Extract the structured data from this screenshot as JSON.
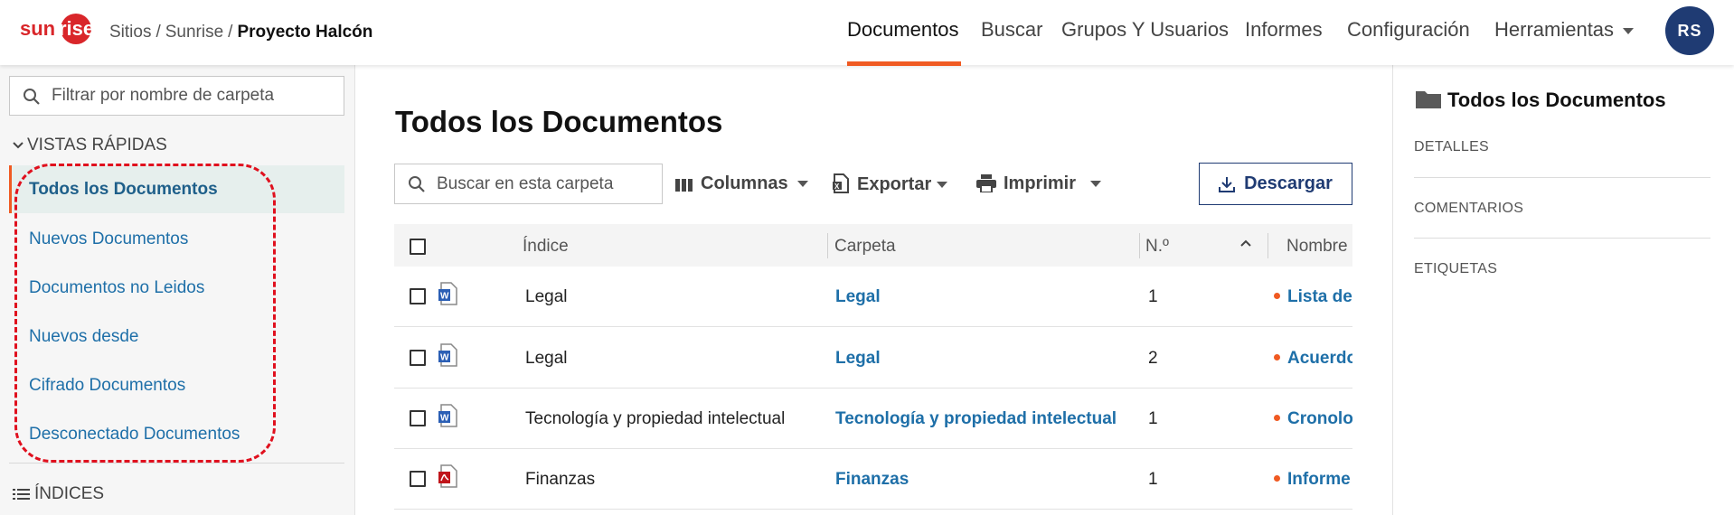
{
  "header": {
    "logo_text": "sunrise",
    "breadcrumb": [
      "Sitios",
      "Sunrise",
      "Proyecto Halcón"
    ],
    "breadcrumb_sep": "/",
    "nav": [
      "Documentos",
      "Buscar",
      "Grupos Y Usuarios",
      "Informes",
      "Configuración",
      "Herramientas"
    ],
    "active_nav": "Documentos",
    "user_initials": "RS"
  },
  "sidebar": {
    "filter_placeholder": "Filtrar por nombre de carpeta",
    "quick_views_title": "VISTAS RÁPIDAS",
    "quick_views": [
      "Todos los Documentos",
      "Nuevos Documentos",
      "Documentos no Leidos",
      "Nuevos desde",
      "Cifrado Documentos",
      "Desconectado Documentos"
    ],
    "active_view": "Todos los Documentos",
    "indices_title": "ÍNDICES"
  },
  "main": {
    "title": "Todos los Documentos",
    "search_placeholder": "Buscar en esta carpeta",
    "toolbar": {
      "columns": "Columnas",
      "export": "Exportar",
      "print": "Imprimir",
      "download": "Descargar"
    },
    "table": {
      "headers": [
        "Índice",
        "Carpeta",
        "N.º",
        "Nombre"
      ],
      "rows": [
        {
          "index": "Legal",
          "folder": "Legal",
          "number": "1",
          "name": "Lista de",
          "file_type": "word"
        },
        {
          "index": "Legal",
          "folder": "Legal",
          "number": "2",
          "name": "Acuerdo",
          "file_type": "word"
        },
        {
          "index": "Tecnología y propiedad intelectual",
          "folder": "Tecnología y propiedad intelectual",
          "number": "1",
          "name": "Cronolog",
          "file_type": "word"
        },
        {
          "index": "Finanzas",
          "folder": "Finanzas",
          "number": "1",
          "name": "Informe",
          "file_type": "pdf"
        }
      ]
    }
  },
  "details_panel": {
    "title": "Todos los Documentos",
    "sections": [
      "DETALLES",
      "COMENTARIOS",
      "ETIQUETAS"
    ]
  },
  "colors": {
    "brand_orange": "#f05a22",
    "brand_red": "#d9262a",
    "navy": "#1f3b73",
    "link_blue": "#1e6fa8",
    "annotation_red": "#e0101e"
  }
}
